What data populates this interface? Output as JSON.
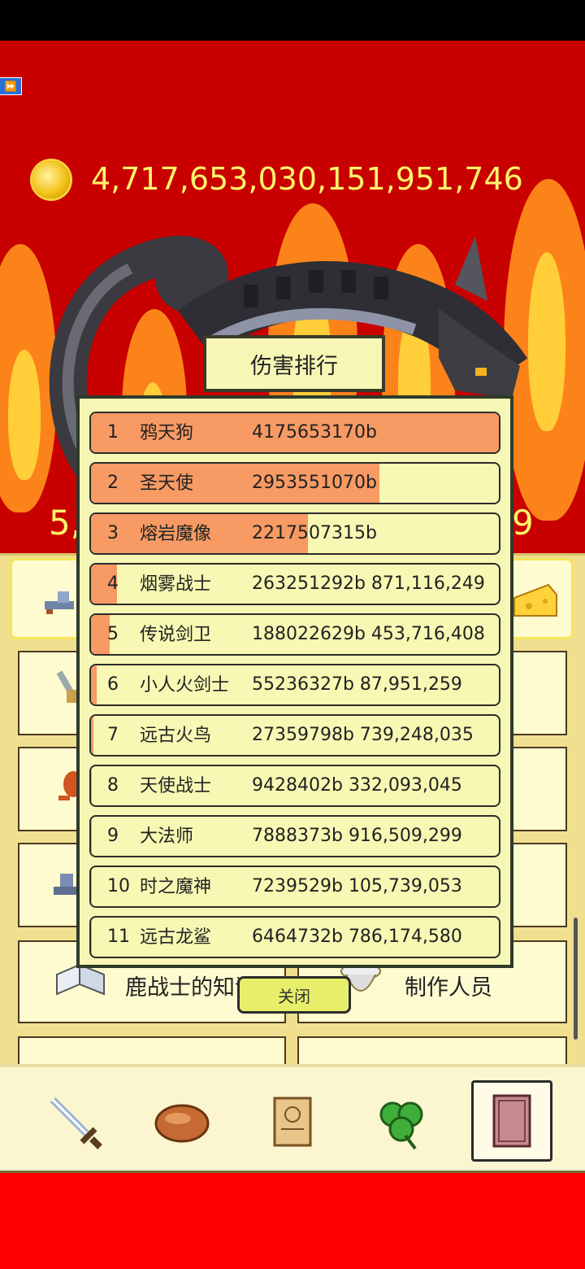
{
  "hud": {
    "fast_forward_icon": "fast-forward-icon",
    "gold": "4,717,653,030,151,951,746",
    "big_left": "5,",
    "big_right": "9"
  },
  "modal": {
    "title": "伤害排行",
    "close_label": "关闭",
    "rows": [
      {
        "rank": "1",
        "name": "鸦天狗",
        "damage": "4175653170b",
        "fill": 1.0
      },
      {
        "rank": "2",
        "name": "圣天使",
        "damage": "2953551070b",
        "fill": 0.707
      },
      {
        "rank": "3",
        "name": "熔岩魔像",
        "damage": "2217507315b",
        "fill": 0.531
      },
      {
        "rank": "4",
        "name": "烟雾战士",
        "damage": "263251292b 871,116,249",
        "fill": 0.063
      },
      {
        "rank": "5",
        "name": "传说剑卫",
        "damage": "188022629b 453,716,408",
        "fill": 0.045
      },
      {
        "rank": "6",
        "name": "小人火剑士",
        "damage": "55236327b 87,951,259",
        "fill": 0.013
      },
      {
        "rank": "7",
        "name": "远古火鸟",
        "damage": "27359798b 739,248,035",
        "fill": 0.0066
      },
      {
        "rank": "8",
        "name": "天使战士",
        "damage": "9428402b 332,093,045",
        "fill": 0.0023
      },
      {
        "rank": "9",
        "name": "大法师",
        "damage": "7888373b 916,509,299",
        "fill": 0.0019
      },
      {
        "rank": "10",
        "name": "时之魔神",
        "damage": "7239529b 105,739,053",
        "fill": 0.0017
      },
      {
        "rank": "11",
        "name": "远古龙鲨",
        "damage": "6464732b 786,174,580",
        "fill": 0.0015
      }
    ]
  },
  "menu": {
    "knowledge_label": "鹿战士的知识",
    "credits_label": "制作人员"
  },
  "nav": {
    "items": [
      "sword-icon",
      "bread-icon",
      "scroll-icon",
      "clover-icon",
      "book-icon"
    ],
    "active": "book-icon"
  }
}
